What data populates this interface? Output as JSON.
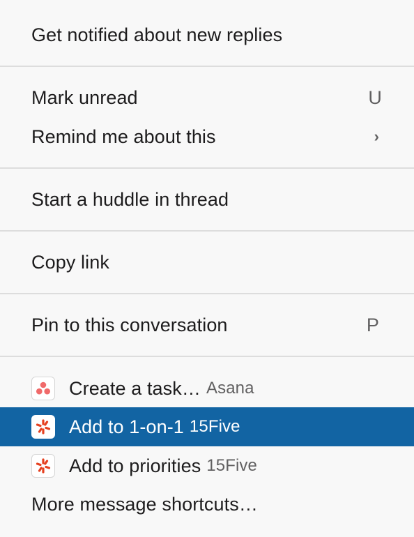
{
  "menu": {
    "notify": {
      "label": "Get notified about new replies"
    },
    "mark_unread": {
      "label": "Mark unread",
      "shortcut": "U"
    },
    "remind": {
      "label": "Remind me about this",
      "chevron": "›"
    },
    "huddle": {
      "label": "Start a huddle in thread"
    },
    "copy_link": {
      "label": "Copy link"
    },
    "pin": {
      "label": "Pin to this conversation",
      "shortcut": "P"
    },
    "apps": [
      {
        "label": "Create a task…",
        "app": "Asana",
        "icon": "asana-icon",
        "selected": false
      },
      {
        "label": "Add to 1-on-1",
        "app": "15Five",
        "icon": "15five-icon",
        "selected": true
      },
      {
        "label": "Add to priorities",
        "app": "15Five",
        "icon": "15five-icon",
        "selected": false
      }
    ],
    "more": {
      "label": "More message shortcuts…"
    }
  },
  "colors": {
    "background": "#f8f8f8",
    "selected": "#1264a3",
    "divider": "#dddddd",
    "asana": "#f06a6a",
    "fifteenfive": "#e5401f"
  }
}
